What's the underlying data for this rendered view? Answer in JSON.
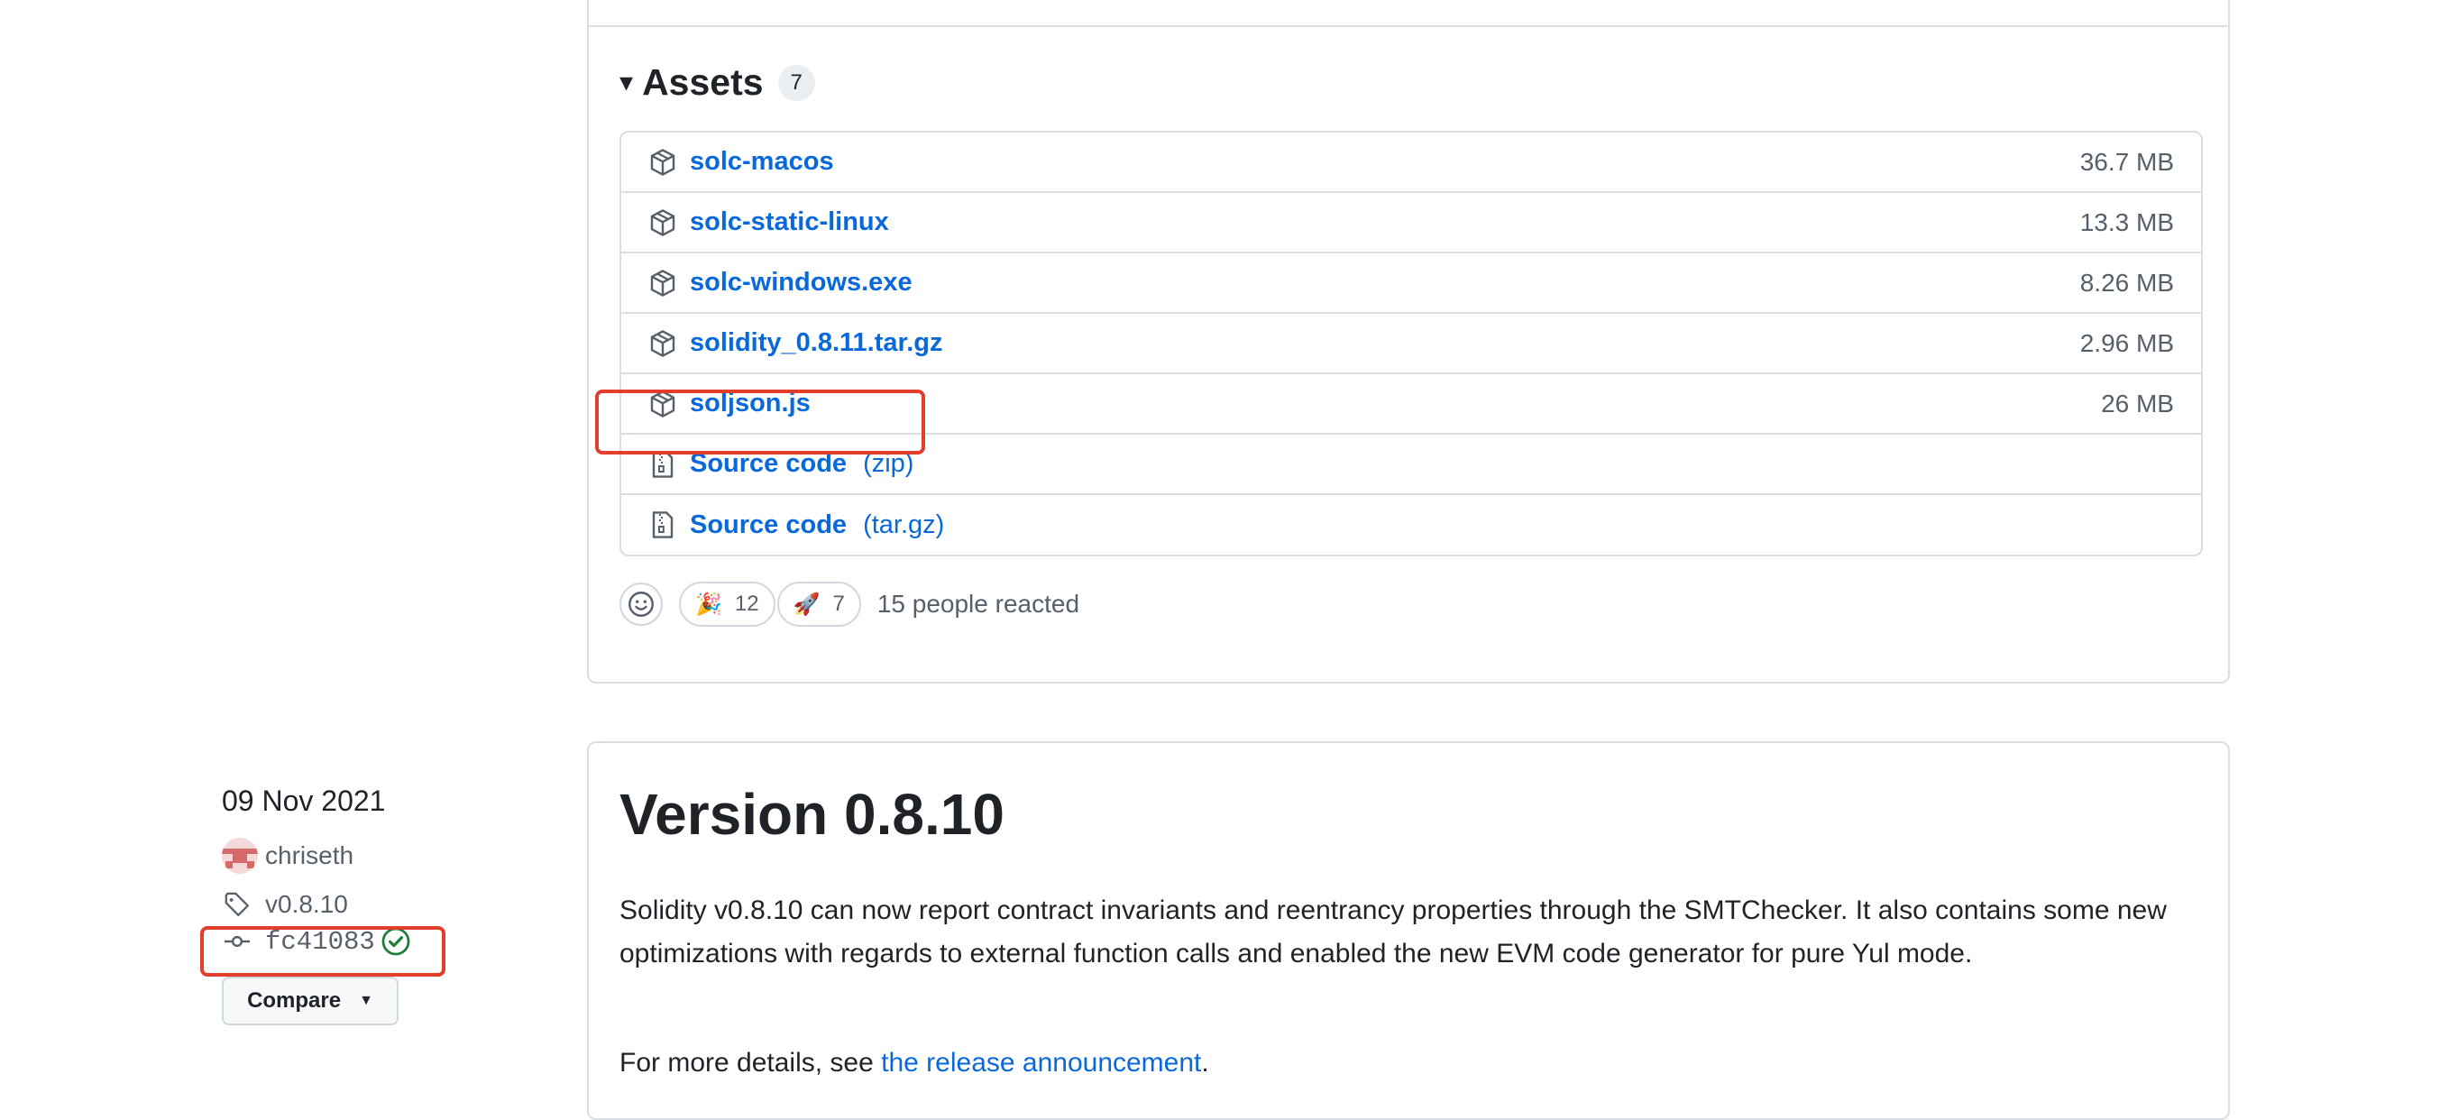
{
  "assets": {
    "title": "Assets",
    "count": "7",
    "items": [
      {
        "name": "solc-macos",
        "type": "",
        "size": "36.7 MB"
      },
      {
        "name": "solc-static-linux",
        "type": "",
        "size": "13.3 MB"
      },
      {
        "name": "solc-windows.exe",
        "type": "",
        "size": "8.26 MB"
      },
      {
        "name": "solidity_0.8.11.tar.gz",
        "type": "",
        "size": "2.96 MB"
      },
      {
        "name": "soljson.js",
        "type": "",
        "size": "26 MB"
      },
      {
        "name": "Source code",
        "type": "(zip)",
        "size": ""
      },
      {
        "name": "Source code",
        "type": "(tar.gz)",
        "size": ""
      }
    ]
  },
  "reactions": {
    "tada": {
      "emoji": "🎉",
      "count": "12"
    },
    "rocket": {
      "emoji": "🚀",
      "count": "7"
    },
    "summary": "15 people reacted"
  },
  "release": {
    "date": "09 Nov 2021",
    "author": "chriseth",
    "tag": "v0.8.10",
    "commit": "fc41083",
    "compare_label": "Compare",
    "title": "Version 0.8.10",
    "body": "Solidity v0.8.10 can now report contract invariants and reentrancy properties through the SMTChecker. It also contains some new optimizations with regards to external function calls and enabled the new EVM code generator for pure Yul mode.",
    "more_prefix": "For more details, see ",
    "more_link": "the release announcement",
    "more_suffix": "."
  },
  "colors": {
    "accent": "#0969da",
    "highlight": "#e23e2b",
    "verified": "#1a7f37"
  }
}
